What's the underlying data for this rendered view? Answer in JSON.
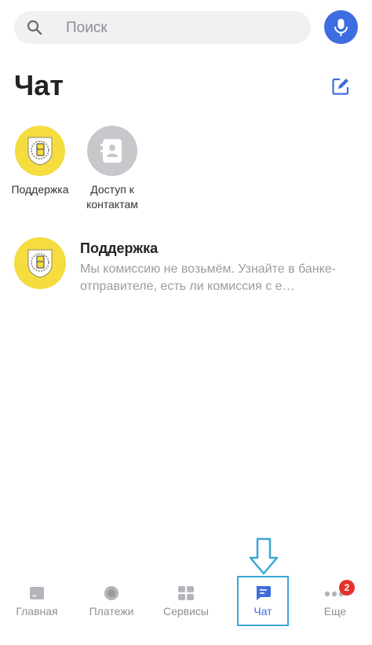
{
  "search": {
    "placeholder": "Поиск"
  },
  "header": {
    "title": "Чат"
  },
  "stories": [
    {
      "label": "Поддержка"
    },
    {
      "label": "Доступ к контактам"
    }
  ],
  "chats": [
    {
      "name": "Поддержка",
      "preview": "Мы комиссию не возьмём. Узнайте в банке-отправителе, есть ли комиссия с е…"
    }
  ],
  "tabbar": {
    "items": [
      {
        "label": "Главная",
        "icon": "home-card-icon"
      },
      {
        "label": "Платежи",
        "icon": "payments-circle-icon"
      },
      {
        "label": "Сервисы",
        "icon": "services-grid-icon"
      },
      {
        "label": "Чат",
        "icon": "chat-bubble-icon",
        "active": true
      },
      {
        "label": "Еще",
        "icon": "more-dots-icon",
        "badge": "2"
      }
    ]
  },
  "colors": {
    "accent": "#3d6de0",
    "brand_yellow": "#f5dc3f",
    "badge_red": "#e5312b",
    "annotation": "#3aa6d8"
  }
}
